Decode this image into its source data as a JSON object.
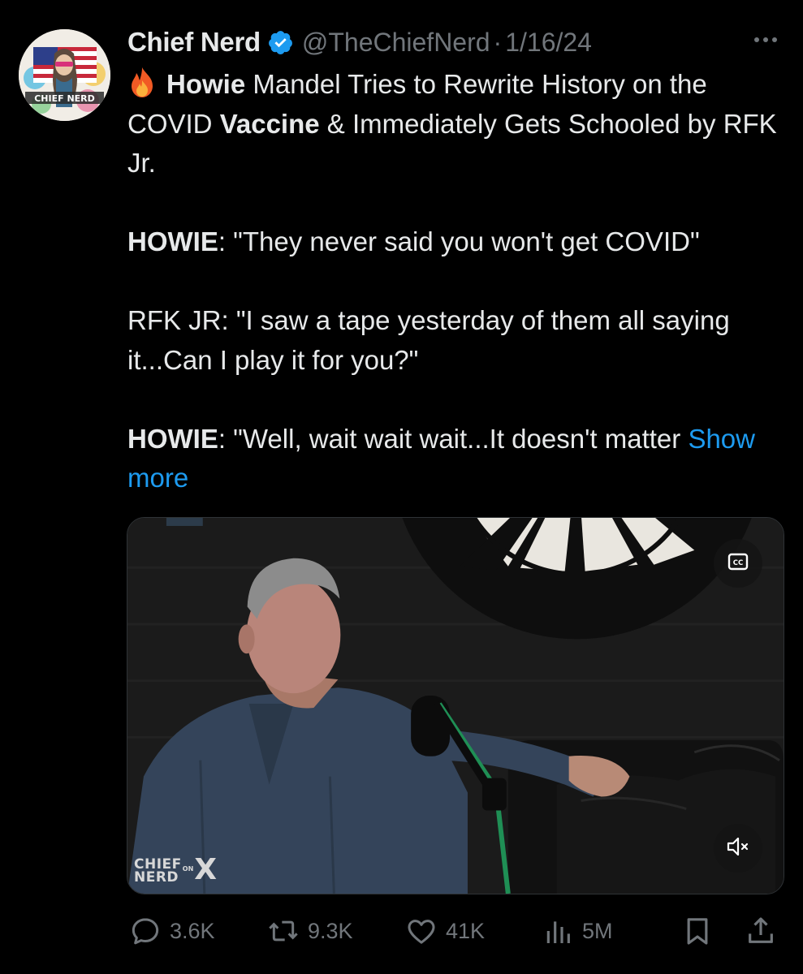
{
  "tweet": {
    "author_name": "Chief Nerd",
    "handle": "@TheChiefNerd",
    "separator": "·",
    "date": "1/16/24",
    "avatar_label": "CHIEF NERD",
    "text": {
      "line1_bold": "Howie",
      "line1_rest": " Mandel Tries to Rewrite History on the COVID ",
      "line1_bold2": "Vaccine",
      "line1_end": " & Immediately Gets Schooled by RFK Jr.",
      "quote1_speaker": "HOWIE",
      "quote1_text": ": \"They never said you won't get COVID\"",
      "quote2_text": "RFK JR: \"I saw a tape yesterday of them all saying it...Can I play it for you?\"",
      "quote3_speaker": "HOWIE",
      "quote3_text": ": \"Well, wait wait wait...It doesn't matter ",
      "show_more": "Show more"
    }
  },
  "media": {
    "watermark_line1": "CHIEF",
    "watermark_line2": "NERD",
    "watermark_on": "ON",
    "watermark_x": "X"
  },
  "actions": {
    "replies": "3.6K",
    "reposts": "9.3K",
    "likes": "41K",
    "views": "5M"
  },
  "colors": {
    "background": "#000000",
    "text": "#e7e9ea",
    "secondary": "#71767b",
    "link": "#1d9bf0",
    "verified": "#1d9bf0"
  },
  "icons": [
    "verified-badge-icon",
    "more-icon",
    "fire-emoji-icon",
    "closed-captions-icon",
    "mute-icon",
    "reply-icon",
    "repost-icon",
    "like-icon",
    "views-icon",
    "bookmark-icon",
    "share-icon"
  ]
}
